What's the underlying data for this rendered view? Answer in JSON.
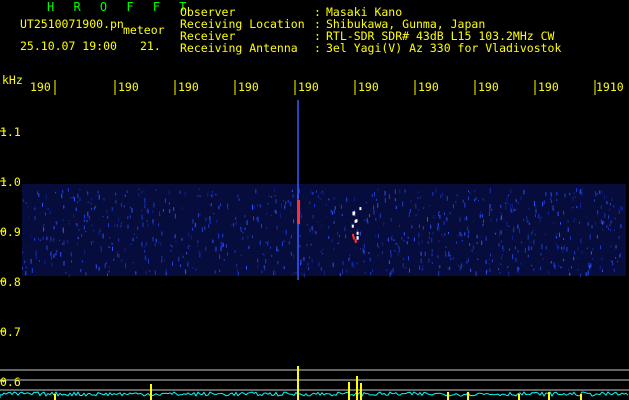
{
  "header": {
    "app_title": "H R O F F T",
    "file_name": "UT2510071900.pn",
    "source_tag": "meteor",
    "timestamp": "25.10.07 19:00",
    "count": "21.",
    "fields": [
      {
        "label": "Observer",
        "sep": ":",
        "value": "Masaki Kano"
      },
      {
        "label": "Receiving Location",
        "sep": ":",
        "value": "Shibukawa, Gunma, Japan"
      },
      {
        "label": "Receiver",
        "sep": ":",
        "value": "RTL-SDR SDR# 43dB L15 103.2MHz CW"
      },
      {
        "label": "Receiving Antenna",
        "sep": ":",
        "value": "3el Yagi(V) Az 330 for Vladivostok"
      }
    ]
  },
  "axis": {
    "unit": "kHz",
    "y_labels": [
      "1.1",
      "1.0",
      "0.9",
      "0.8",
      "0.7",
      "0.6"
    ],
    "time_labels": [
      "190",
      "190",
      "190",
      "190",
      "190",
      "190",
      "190",
      "190",
      "190",
      "1910"
    ]
  },
  "colors": {
    "background": "#000000",
    "text": "#ffff00",
    "title": "#00ff00",
    "noise_band": "#0a1a7a",
    "signal": "#ff3030",
    "level_trace": "#00ffff",
    "level_peaks": "#ffff00",
    "grid_lines": "#c8c8c8"
  },
  "spectrogram": {
    "meteor_echoes": [
      {
        "time_fraction": 0.457,
        "strength": "strong"
      },
      {
        "time_fraction": 0.553,
        "strength": "cluster"
      }
    ]
  }
}
